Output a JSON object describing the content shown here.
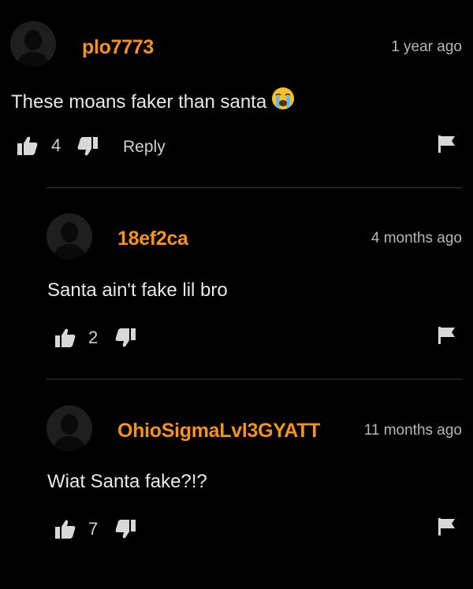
{
  "comments": [
    {
      "username": "plo7773",
      "timestamp": "1 year ago",
      "text": "These moans faker than santa",
      "emoji": "crying-face",
      "likes": "4",
      "reply_label": "Reply"
    },
    {
      "username": "18ef2ca",
      "timestamp": "4 months ago",
      "text": "Santa ain't fake lil bro",
      "likes": "2"
    },
    {
      "username": "OhioSigmaLvl3GYATT",
      "timestamp": "11 months ago",
      "text": "Wiat Santa fake?!?",
      "likes": "7"
    }
  ],
  "colors": {
    "background": "#000000",
    "username": "#f7921e",
    "text": "#e8e8e8",
    "muted": "#b8b8b8"
  }
}
